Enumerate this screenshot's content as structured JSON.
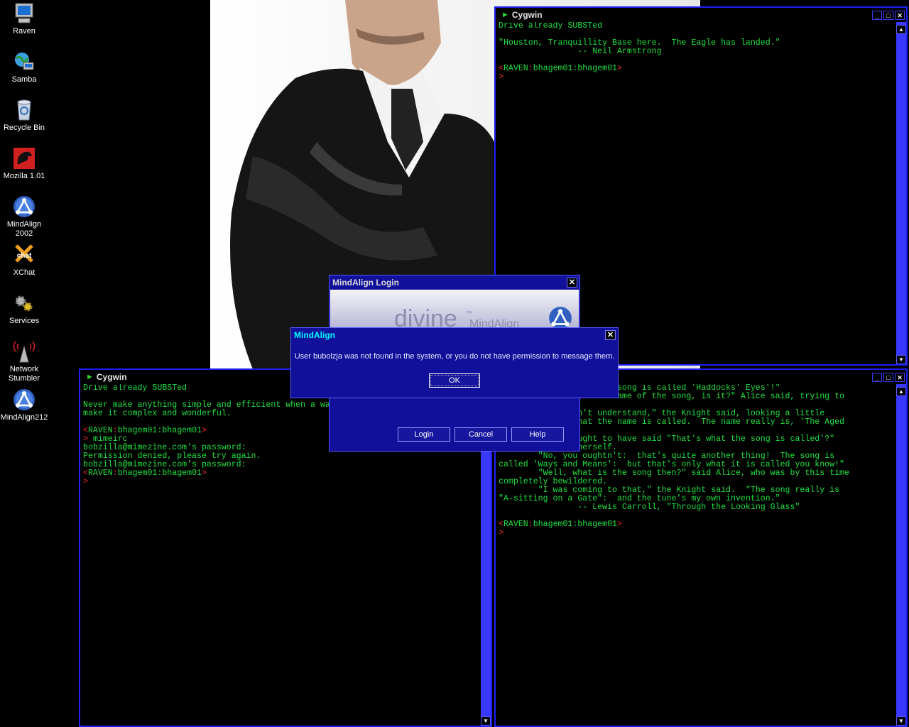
{
  "desktop": {
    "icons": [
      {
        "label": "Raven"
      },
      {
        "label": "Samba"
      },
      {
        "label": "Recycle Bin"
      },
      {
        "label": "Mozilla 1.01"
      },
      {
        "label": "MindAlign 2002"
      },
      {
        "label": "XChat"
      },
      {
        "label": "Services"
      },
      {
        "label": "Network Stumbler"
      },
      {
        "label": "MindAlign212"
      }
    ]
  },
  "wallpaper": {
    "alt_icon": "photo-wallpaper"
  },
  "term_top": {
    "title": "Cygwin",
    "lines": [
      "Drive already SUBSTed",
      "",
      "\"Houston, Tranquillity Base here.  The Eagle has landed.\"",
      "                -- Neil Armstrong",
      ""
    ],
    "prompt_user": "RAVEN",
    "prompt_path": "bhagem01:bhagem01",
    "caret": ">"
  },
  "term_left": {
    "title": "Cygwin",
    "lines": [
      "Drive already SUBSTed",
      "",
      "Never make anything simple and efficient when a wa",
      "make it complex and wonderful.",
      ""
    ],
    "prompt_user": "RAVEN",
    "prompt_path": "bhagem01:bhagem01",
    "cmd": " mimeirc",
    "lines2": [
      "bobzilla@mimezine.com's password:",
      "Permission denied, please try again.",
      "bobzilla@mimezine.com's password:"
    ],
    "caret": ">"
  },
  "term_right": {
    "lines": [
      "               e of the song is called 'Haddocks' Eyes'!\"",
      "               t's the name of the song, is it?\" Alice said, trying to",
      "",
      "              don't understand,\" the Knight said, looking a little",
      "               what the name is called.  The name really is, 'The Aged",
      "",
      "               ought to have said \"That's what the song is called'?\"",
      "Alice corrected herself.",
      "        \"No, you oughtn't:  that's quite another thing!  The song is",
      "called 'Ways and Means':  but that's only what it is called you know!\"",
      "        \"Well, what is the song then?\" said Alice, who was by this time",
      "completely bewildered.",
      "        \"I was coming to that,\" the Knight said.  \"The song really is",
      "\"A-sitting on a Gate\":  and the tune's my own invention.\"",
      "                -- Lewis Carroll, \"Through the Looking Glass\"",
      ""
    ],
    "prompt_user": "RAVEN",
    "prompt_path": "bhagem01:bhagem01",
    "caret": ">"
  },
  "login_dialog": {
    "title": "MindAlign Login",
    "banner": "divine",
    "banner_tm": "™",
    "banner_product": "MindAlign",
    "login_label": "Login",
    "cancel_label": "Cancel",
    "help_label": "Help"
  },
  "alert_dialog": {
    "title": "MindAlign",
    "message": "User bubolzja was not found in the system, or you do not have permission to message them.",
    "ok_label": "OK"
  },
  "colors": {
    "term_text": "#20e040",
    "prompt_red": "#ff2a2a",
    "window_border": "#1e1ef5",
    "dialog_bg": "#10109a",
    "alert_title": "#00ffff"
  }
}
